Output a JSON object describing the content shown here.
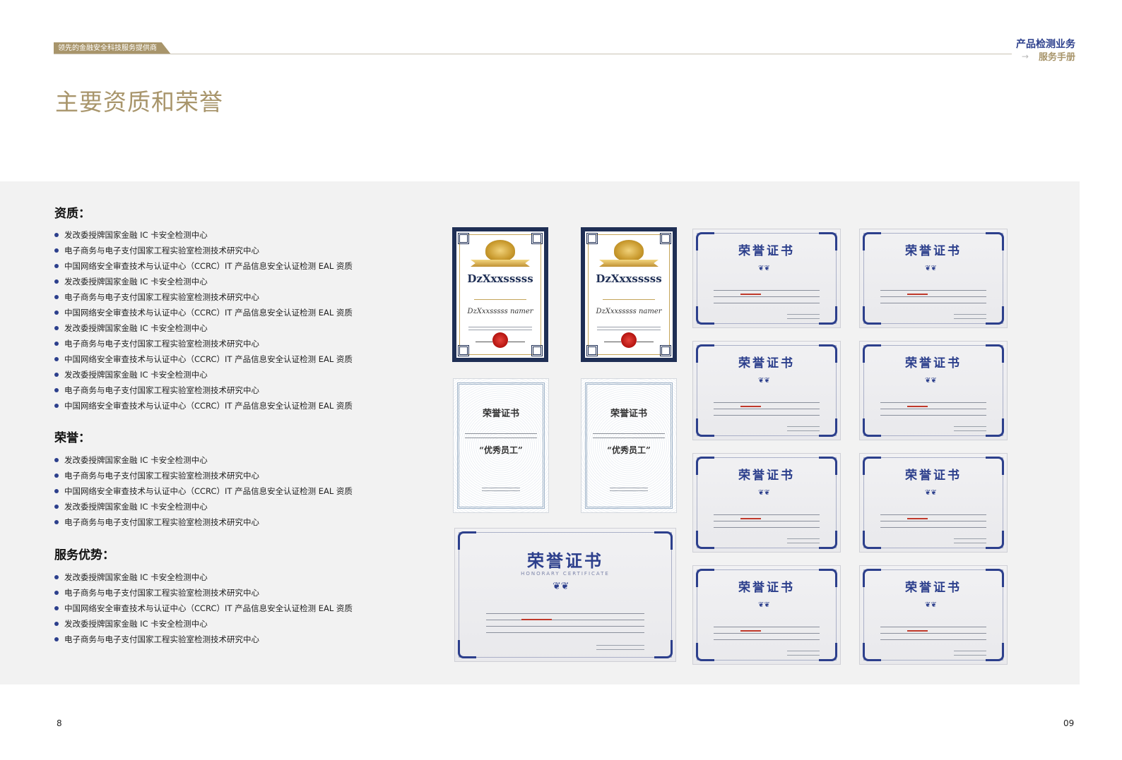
{
  "header": {
    "tag": "领先的金融安全科技服务提供商",
    "brand_title": "产品检测业务",
    "brand_sub": "服务手册"
  },
  "page_title": "主要资质和荣誉",
  "sections": [
    {
      "title": "资质：",
      "items": [
        "发改委授牌国家金融 IC 卡安全检测中心",
        "电子商务与电子支付国家工程实验室检测技术研究中心",
        "中国网络安全审查技术与认证中心（CCRC）IT 产品信息安全认证检测 EAL 资质",
        "发改委授牌国家金融 IC 卡安全检测中心",
        "电子商务与电子支付国家工程实验室检测技术研究中心",
        "中国网络安全审查技术与认证中心（CCRC）IT 产品信息安全认证检测 EAL 资质",
        "发改委授牌国家金融 IC 卡安全检测中心",
        "电子商务与电子支付国家工程实验室检测技术研究中心",
        "中国网络安全审查技术与认证中心（CCRC）IT 产品信息安全认证检测 EAL 资质",
        "发改委授牌国家金融 IC 卡安全检测中心",
        "电子商务与电子支付国家工程实验室检测技术研究中心",
        "中国网络安全审查技术与认证中心（CCRC）IT 产品信息安全认证检测 EAL 资质"
      ]
    },
    {
      "title": "荣誉：",
      "items": [
        "发改委授牌国家金融 IC 卡安全检测中心",
        "电子商务与电子支付国家工程实验室检测技术研究中心",
        "中国网络安全审查技术与认证中心（CCRC）IT 产品信息安全认证检测 EAL 资质",
        "发改委授牌国家金融 IC 卡安全检测中心",
        "电子商务与电子支付国家工程实验室检测技术研究中心"
      ]
    },
    {
      "title": "服务优势：",
      "items": [
        "发改委授牌国家金融 IC 卡安全检测中心",
        "电子商务与电子支付国家工程实验室检测技术研究中心",
        "中国网络安全审查技术与认证中心（CCRC）IT 产品信息安全认证检测 EAL 资质",
        "发改委授牌国家金融 IC 卡安全检测中心",
        "电子商务与电子支付国家工程实验室检测技术研究中心"
      ]
    }
  ],
  "certificates": {
    "gold_name": "DzXxxsssss",
    "gold_script": "DzXxxsssss namer",
    "silver_title": "荣誉证书",
    "silver_quote": "“优秀员工”",
    "blue_title": "荣誉证书",
    "blue_sub": "HONORARY CERTIFICATE"
  },
  "footer": {
    "page_left": "8",
    "page_right": "09"
  },
  "colors": {
    "gold": "#a8956b",
    "navy": "#2c3f8c",
    "panel": "#f2f2f2"
  }
}
